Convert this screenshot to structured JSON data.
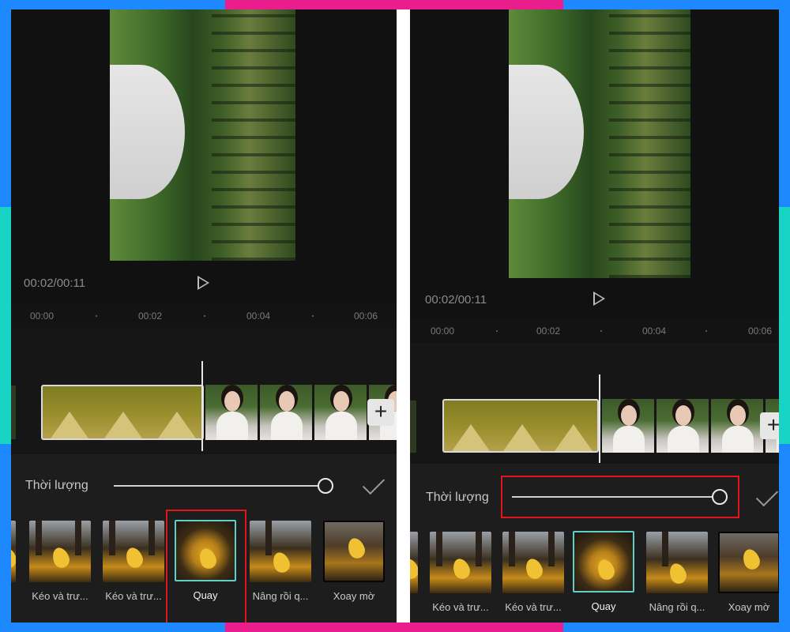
{
  "panels": [
    {
      "time": "00:02/00:11",
      "ruler": [
        "00:00",
        "00:02",
        "00:04",
        "00:06"
      ],
      "duration_label": "Thời lượng",
      "duration_value": 1.0,
      "effects": [
        {
          "label": "Kéo và trư..."
        },
        {
          "label": "Kéo và trư..."
        },
        {
          "label": "Quay",
          "selected": true
        },
        {
          "label": "Nâng rồi q..."
        },
        {
          "label": "Xoay mờ"
        }
      ]
    },
    {
      "time": "00:02/00:11",
      "ruler": [
        "00:00",
        "00:02",
        "00:04",
        "00:06"
      ],
      "duration_label": "Thời lượng",
      "duration_value": 1.0,
      "effects": [
        {
          "label": "Kéo và trư..."
        },
        {
          "label": "Kéo và trư..."
        },
        {
          "label": "Quay",
          "selected": true
        },
        {
          "label": "Nâng rồi q..."
        },
        {
          "label": "Xoay mờ"
        }
      ]
    }
  ],
  "icons": {
    "play": "play-icon",
    "add": "plus-icon",
    "confirm": "checkmark-icon"
  },
  "colors": {
    "frame_blue": "#1e88ff",
    "frame_pink": "#e91e8c",
    "frame_teal": "#17d4c4",
    "highlight_red": "#e0161b",
    "selected_teal": "#5ed0c6"
  }
}
